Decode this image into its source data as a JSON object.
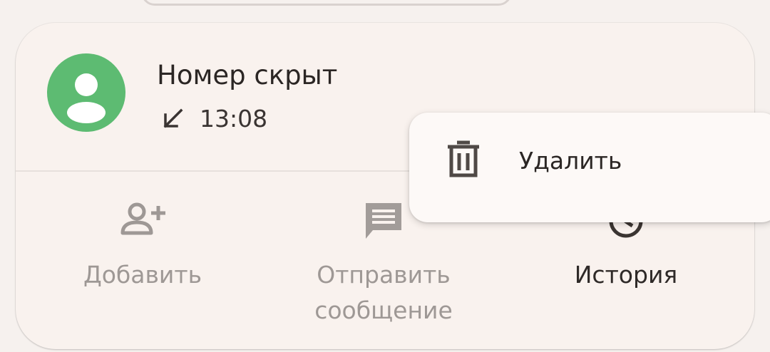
{
  "call_entry": {
    "caller": "Номер скрыт",
    "direction_icon": "incoming-call-arrow-icon",
    "time": "13:08",
    "avatar_color": "#5dbb72"
  },
  "actions": [
    {
      "label": "Добавить",
      "icon": "add-contact-icon",
      "state": "disabled"
    },
    {
      "label": "Отправить сообщение",
      "icon": "message-icon",
      "state": "disabled"
    },
    {
      "label": "История",
      "icon": "history-icon",
      "state": "enabled"
    }
  ],
  "context_menu": {
    "items": [
      {
        "label": "Удалить",
        "icon": "trash-icon"
      }
    ]
  },
  "colors": {
    "background": "#f6f1ee",
    "card": "#f9f2ee",
    "menu": "#fdf9f7",
    "text": "#2b2624",
    "disabled_text": "#9e9895"
  }
}
